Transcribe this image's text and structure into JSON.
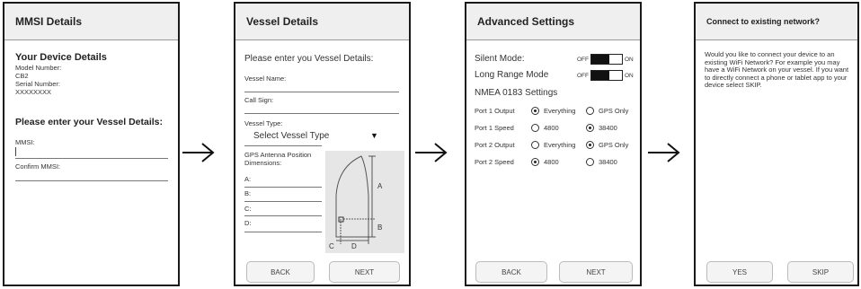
{
  "screen1": {
    "title": "MMSI Details",
    "device_heading": "Your Device Details",
    "model_label": "Model Number:",
    "model_value": "CB2",
    "serial_label": "Serial Number:",
    "serial_value": "XXXXXXXX",
    "prompt": "Please enter your Vessel Details:",
    "mmsi_label": "MMSI:",
    "confirm_label": "Confirm MMSI:"
  },
  "screen2": {
    "title": "Vessel Details",
    "prompt": "Please enter you Vessel Details:",
    "vessel_name_label": "Vessel Name:",
    "call_sign_label": "Call Sign:",
    "vessel_type_label": "Vessel Type:",
    "vessel_type_select": "Select Vessel Type",
    "gps_label": "GPS Antenna Position Dimensions:",
    "a_label": "A:",
    "b_label": "B:",
    "c_label": "C:",
    "d_label": "D:",
    "diagram": {
      "a": "A",
      "b": "B",
      "c": "C",
      "d": "D"
    },
    "back_button": "BACK",
    "next_button": "NEXT"
  },
  "screen3": {
    "title": "Advanced Settings",
    "silent_mode": "Silent Mode:",
    "long_range_mode": "Long Range Mode",
    "off": "OFF",
    "on": "ON",
    "nmea_heading": "NMEA 0183 Settings",
    "port1_output_label": "Port 1 Output",
    "port1_speed_label": "Port 1 Speed",
    "port2_output_label": "Port 2 Output",
    "port2_speed_label": "Port 2 Speed",
    "everything": "Everything",
    "gps_only": "GPS Only",
    "speed_4800": "4800",
    "speed_38400": "38400",
    "back_button": "BACK",
    "next_button": "NEXT"
  },
  "screen4": {
    "title": "Connect to existing network?",
    "message": "Would you like to connect your device to an existing WiFi Network? For example you may have a WiFi Network on your vessel. If you want to directly connect a phone or tablet app to your device select SKIP.",
    "yes_button": "YES",
    "skip_button": "SKIP"
  }
}
